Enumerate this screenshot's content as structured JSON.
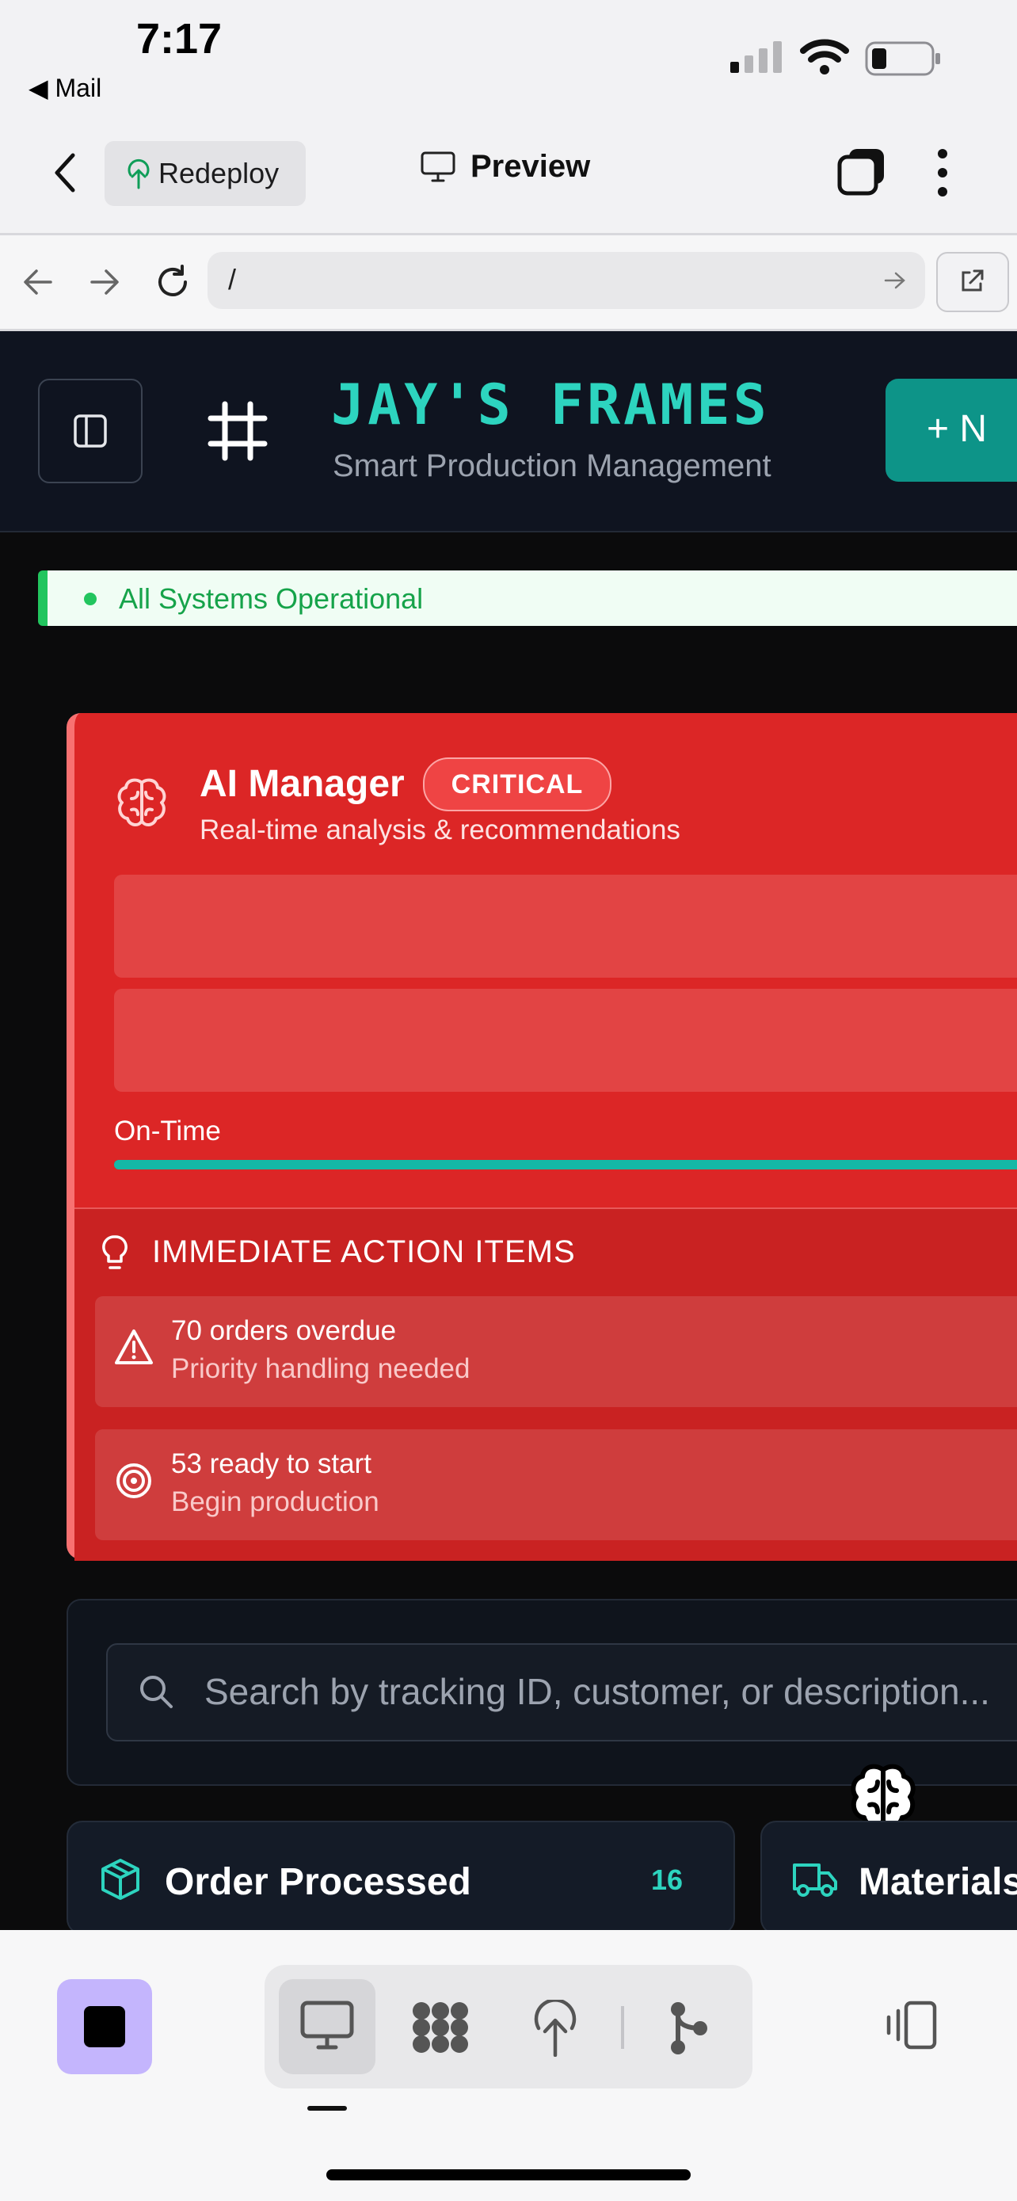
{
  "status_bar": {
    "time": "7:17",
    "back_app": "◀ Mail"
  },
  "toolbar": {
    "redeploy_label": "Redeploy",
    "preview_label": "Preview"
  },
  "browser": {
    "url": "/"
  },
  "app": {
    "brand_title": "JAY'S FRAMES",
    "brand_subtitle": "Smart Production Management",
    "new_button_label": "+ N",
    "system_status": "All Systems Operational"
  },
  "ai_manager": {
    "title": "AI Manager",
    "badge": "CRITICAL",
    "subtitle": "Real-time analysis & recommendations",
    "ontime_label": "On-Time",
    "ontime_fraction": 1.0,
    "actions_title": "IMMEDIATE ACTION ITEMS",
    "actions": [
      {
        "title": "70 orders overdue",
        "subtitle": "Priority handling needed",
        "icon": "warning-icon"
      },
      {
        "title": "53 ready to start",
        "subtitle": "Begin production",
        "icon": "target-icon"
      }
    ]
  },
  "search": {
    "placeholder": "Search by tracking ID, customer, or description..."
  },
  "columns": [
    {
      "title": "Order Processed",
      "count": "16",
      "icon": "box-icon"
    },
    {
      "title": "Materials",
      "count": "",
      "icon": "truck-icon"
    }
  ],
  "colors": {
    "accent": "#2dd4bf",
    "critical": "#dc2626",
    "ok": "#22c55e"
  }
}
